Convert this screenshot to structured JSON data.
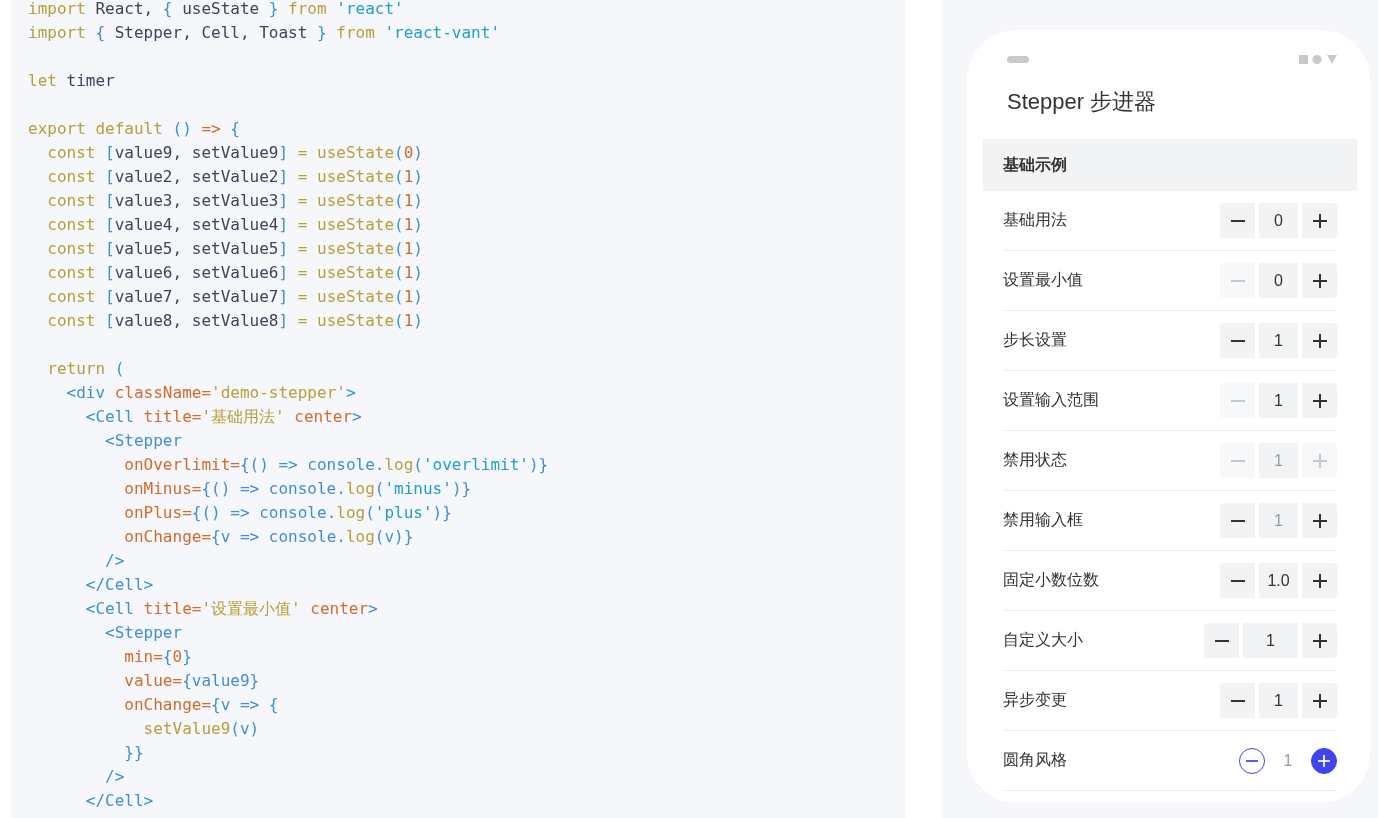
{
  "code": {
    "lines": [
      {
        "tokens": [
          {
            "kind": "keyword",
            "text": "import"
          },
          {
            "kind": "plain",
            "text": " React, "
          },
          {
            "kind": "tag",
            "text": "{"
          },
          {
            "kind": "plain",
            "text": " useState "
          },
          {
            "kind": "tag",
            "text": "}"
          },
          {
            "kind": "keyword",
            "text": " from "
          },
          {
            "kind": "string",
            "text": "'react'"
          }
        ]
      },
      {
        "tokens": [
          {
            "kind": "keyword",
            "text": "import"
          },
          {
            "kind": "tag",
            "text": " {"
          },
          {
            "kind": "plain",
            "text": " Stepper, Cell, Toast "
          },
          {
            "kind": "tag",
            "text": "}"
          },
          {
            "kind": "keyword",
            "text": " from "
          },
          {
            "kind": "string",
            "text": "'react-vant'"
          }
        ]
      },
      {
        "space_before": true,
        "tokens": [
          {
            "kind": "keyword",
            "text": "let"
          },
          {
            "kind": "plain",
            "text": " timer"
          }
        ]
      },
      {
        "space_before": true,
        "tokens": [
          {
            "kind": "keyword",
            "text": "export default"
          },
          {
            "kind": "tag",
            "text": " ()"
          },
          {
            "kind": "attr",
            "text": " =>"
          },
          {
            "kind": "tag",
            "text": " {"
          }
        ]
      },
      {
        "tokens": [
          {
            "kind": "keyword",
            "text": "  const"
          },
          {
            "kind": "tag",
            "text": " ["
          },
          {
            "kind": "plain",
            "text": "value9, setValue9"
          },
          {
            "kind": "tag",
            "text": "]"
          },
          {
            "kind": "keyword",
            "text": " = useState"
          },
          {
            "kind": "tag",
            "text": "("
          },
          {
            "kind": "number",
            "text": "0"
          },
          {
            "kind": "tag",
            "text": ")"
          }
        ]
      },
      {
        "tokens": [
          {
            "kind": "keyword",
            "text": "  const"
          },
          {
            "kind": "tag",
            "text": " ["
          },
          {
            "kind": "plain",
            "text": "value2, setValue2"
          },
          {
            "kind": "tag",
            "text": "]"
          },
          {
            "kind": "keyword",
            "text": " = useState"
          },
          {
            "kind": "tag",
            "text": "("
          },
          {
            "kind": "number",
            "text": "1"
          },
          {
            "kind": "tag",
            "text": ")"
          }
        ]
      },
      {
        "tokens": [
          {
            "kind": "keyword",
            "text": "  const"
          },
          {
            "kind": "tag",
            "text": " ["
          },
          {
            "kind": "plain",
            "text": "value3, setValue3"
          },
          {
            "kind": "tag",
            "text": "]"
          },
          {
            "kind": "keyword",
            "text": " = useState"
          },
          {
            "kind": "tag",
            "text": "("
          },
          {
            "kind": "number",
            "text": "1"
          },
          {
            "kind": "tag",
            "text": ")"
          }
        ]
      },
      {
        "tokens": [
          {
            "kind": "keyword",
            "text": "  const"
          },
          {
            "kind": "tag",
            "text": " ["
          },
          {
            "kind": "plain",
            "text": "value4, setValue4"
          },
          {
            "kind": "tag",
            "text": "]"
          },
          {
            "kind": "keyword",
            "text": " = useState"
          },
          {
            "kind": "tag",
            "text": "("
          },
          {
            "kind": "number",
            "text": "1"
          },
          {
            "kind": "tag",
            "text": ")"
          }
        ]
      },
      {
        "tokens": [
          {
            "kind": "keyword",
            "text": "  const"
          },
          {
            "kind": "tag",
            "text": " ["
          },
          {
            "kind": "plain",
            "text": "value5, setValue5"
          },
          {
            "kind": "tag",
            "text": "]"
          },
          {
            "kind": "keyword",
            "text": " = useState"
          },
          {
            "kind": "tag",
            "text": "("
          },
          {
            "kind": "number",
            "text": "1"
          },
          {
            "kind": "tag",
            "text": ")"
          }
        ]
      },
      {
        "tokens": [
          {
            "kind": "keyword",
            "text": "  const"
          },
          {
            "kind": "tag",
            "text": " ["
          },
          {
            "kind": "plain",
            "text": "value6, setValue6"
          },
          {
            "kind": "tag",
            "text": "]"
          },
          {
            "kind": "keyword",
            "text": " = useState"
          },
          {
            "kind": "tag",
            "text": "("
          },
          {
            "kind": "number",
            "text": "1"
          },
          {
            "kind": "tag",
            "text": ")"
          }
        ]
      },
      {
        "tokens": [
          {
            "kind": "keyword",
            "text": "  const"
          },
          {
            "kind": "tag",
            "text": " ["
          },
          {
            "kind": "plain",
            "text": "value7, setValue7"
          },
          {
            "kind": "tag",
            "text": "]"
          },
          {
            "kind": "keyword",
            "text": " = useState"
          },
          {
            "kind": "tag",
            "text": "("
          },
          {
            "kind": "number",
            "text": "1"
          },
          {
            "kind": "tag",
            "text": ")"
          }
        ]
      },
      {
        "tokens": [
          {
            "kind": "keyword",
            "text": "  const"
          },
          {
            "kind": "tag",
            "text": " ["
          },
          {
            "kind": "plain",
            "text": "value8, setValue8"
          },
          {
            "kind": "tag",
            "text": "]"
          },
          {
            "kind": "keyword",
            "text": " = useState"
          },
          {
            "kind": "tag",
            "text": "("
          },
          {
            "kind": "number",
            "text": "1"
          },
          {
            "kind": "tag",
            "text": ")"
          }
        ]
      },
      {
        "space_before": true,
        "tokens": [
          {
            "kind": "keyword",
            "text": "  return"
          },
          {
            "kind": "tag",
            "text": " ("
          }
        ]
      },
      {
        "tokens": [
          {
            "kind": "tag",
            "text": "    <div"
          },
          {
            "kind": "attr",
            "text": " className="
          },
          {
            "kind": "keyword",
            "text": "'demo-stepper'"
          },
          {
            "kind": "tag",
            "text": ">"
          }
        ]
      },
      {
        "tokens": [
          {
            "kind": "tag",
            "text": "      <Cell"
          },
          {
            "kind": "attr",
            "text": " title="
          },
          {
            "kind": "keyword",
            "text": "'基础用法'"
          },
          {
            "kind": "attr",
            "text": " center"
          },
          {
            "kind": "tag",
            "text": ">"
          }
        ]
      },
      {
        "tokens": [
          {
            "kind": "tag",
            "text": "        <Stepper"
          }
        ]
      },
      {
        "tokens": [
          {
            "kind": "attr",
            "text": "          onOverlimit="
          },
          {
            "kind": "tag",
            "text": "{() => console."
          },
          {
            "kind": "keyword",
            "text": "log"
          },
          {
            "kind": "tag",
            "text": "("
          },
          {
            "kind": "string",
            "text": "'overlimit'"
          },
          {
            "kind": "tag",
            "text": ")}"
          }
        ]
      },
      {
        "tokens": [
          {
            "kind": "attr",
            "text": "          onMinus="
          },
          {
            "kind": "tag",
            "text": "{() => console."
          },
          {
            "kind": "keyword",
            "text": "log"
          },
          {
            "kind": "tag",
            "text": "("
          },
          {
            "kind": "string",
            "text": "'minus'"
          },
          {
            "kind": "tag",
            "text": ")}"
          }
        ]
      },
      {
        "tokens": [
          {
            "kind": "attr",
            "text": "          onPlus="
          },
          {
            "kind": "tag",
            "text": "{() => console."
          },
          {
            "kind": "keyword",
            "text": "log"
          },
          {
            "kind": "tag",
            "text": "("
          },
          {
            "kind": "string",
            "text": "'plus'"
          },
          {
            "kind": "tag",
            "text": ")}"
          }
        ]
      },
      {
        "tokens": [
          {
            "kind": "attr",
            "text": "          onChange="
          },
          {
            "kind": "tag",
            "text": "{v => console."
          },
          {
            "kind": "keyword",
            "text": "log"
          },
          {
            "kind": "tag",
            "text": "(v)}"
          }
        ]
      },
      {
        "tokens": [
          {
            "kind": "tag",
            "text": "        />"
          }
        ]
      },
      {
        "tokens": [
          {
            "kind": "tag",
            "text": "      </Cell>"
          }
        ]
      },
      {
        "tokens": [
          {
            "kind": "tag",
            "text": "      <Cell"
          },
          {
            "kind": "attr",
            "text": " title="
          },
          {
            "kind": "keyword",
            "text": "'设置最小值'"
          },
          {
            "kind": "attr",
            "text": " center"
          },
          {
            "kind": "tag",
            "text": ">"
          }
        ]
      },
      {
        "tokens": [
          {
            "kind": "tag",
            "text": "        <Stepper"
          }
        ]
      },
      {
        "tokens": [
          {
            "kind": "attr",
            "text": "          min="
          },
          {
            "kind": "tag",
            "text": "{"
          },
          {
            "kind": "number",
            "text": "0"
          },
          {
            "kind": "tag",
            "text": "}"
          }
        ]
      },
      {
        "tokens": [
          {
            "kind": "attr",
            "text": "          value="
          },
          {
            "kind": "tag",
            "text": "{value9}"
          }
        ]
      },
      {
        "tokens": [
          {
            "kind": "attr",
            "text": "          onChange="
          },
          {
            "kind": "tag",
            "text": "{v => {"
          }
        ]
      },
      {
        "tokens": [
          {
            "kind": "keyword",
            "text": "            setValue9"
          },
          {
            "kind": "tag",
            "text": "(v)"
          }
        ]
      },
      {
        "tokens": [
          {
            "kind": "tag",
            "text": "          }}"
          }
        ]
      },
      {
        "tokens": [
          {
            "kind": "tag",
            "text": "        />"
          }
        ]
      },
      {
        "tokens": [
          {
            "kind": "tag",
            "text": "      </Cell>"
          }
        ]
      }
    ]
  },
  "phone": {
    "title": "Stepper 步进器",
    "section": "基础示例",
    "rows": [
      {
        "label": "基础用法",
        "kind": "default",
        "value": "0",
        "minus_disabled": false,
        "plus_disabled": false,
        "input_disabled": false
      },
      {
        "label": "设置最小值",
        "kind": "default",
        "value": "0",
        "minus_disabled": true,
        "plus_disabled": false,
        "input_disabled": false
      },
      {
        "label": "步长设置",
        "kind": "default",
        "value": "1",
        "minus_disabled": false,
        "plus_disabled": false,
        "input_disabled": false
      },
      {
        "label": "设置输入范围",
        "kind": "default",
        "value": "1",
        "minus_disabled": true,
        "plus_disabled": false,
        "input_disabled": false
      },
      {
        "label": "禁用状态",
        "kind": "default",
        "value": "1",
        "minus_disabled": true,
        "plus_disabled": true,
        "input_disabled": true
      },
      {
        "label": "禁用输入框",
        "kind": "default",
        "value": "1",
        "minus_disabled": false,
        "plus_disabled": false,
        "input_disabled": true
      },
      {
        "label": "固定小数位数",
        "kind": "default",
        "value": "1.0",
        "minus_disabled": false,
        "plus_disabled": false,
        "input_disabled": false
      },
      {
        "label": "自定义大小",
        "kind": "large",
        "value": "1",
        "minus_disabled": false,
        "plus_disabled": false,
        "input_disabled": false
      },
      {
        "label": "异步变更",
        "kind": "default",
        "value": "1",
        "minus_disabled": false,
        "plus_disabled": false,
        "input_disabled": false
      },
      {
        "label": "圆角风格",
        "kind": "round",
        "value": "1",
        "minus_disabled": false,
        "plus_disabled": false,
        "input_disabled": false
      }
    ]
  }
}
